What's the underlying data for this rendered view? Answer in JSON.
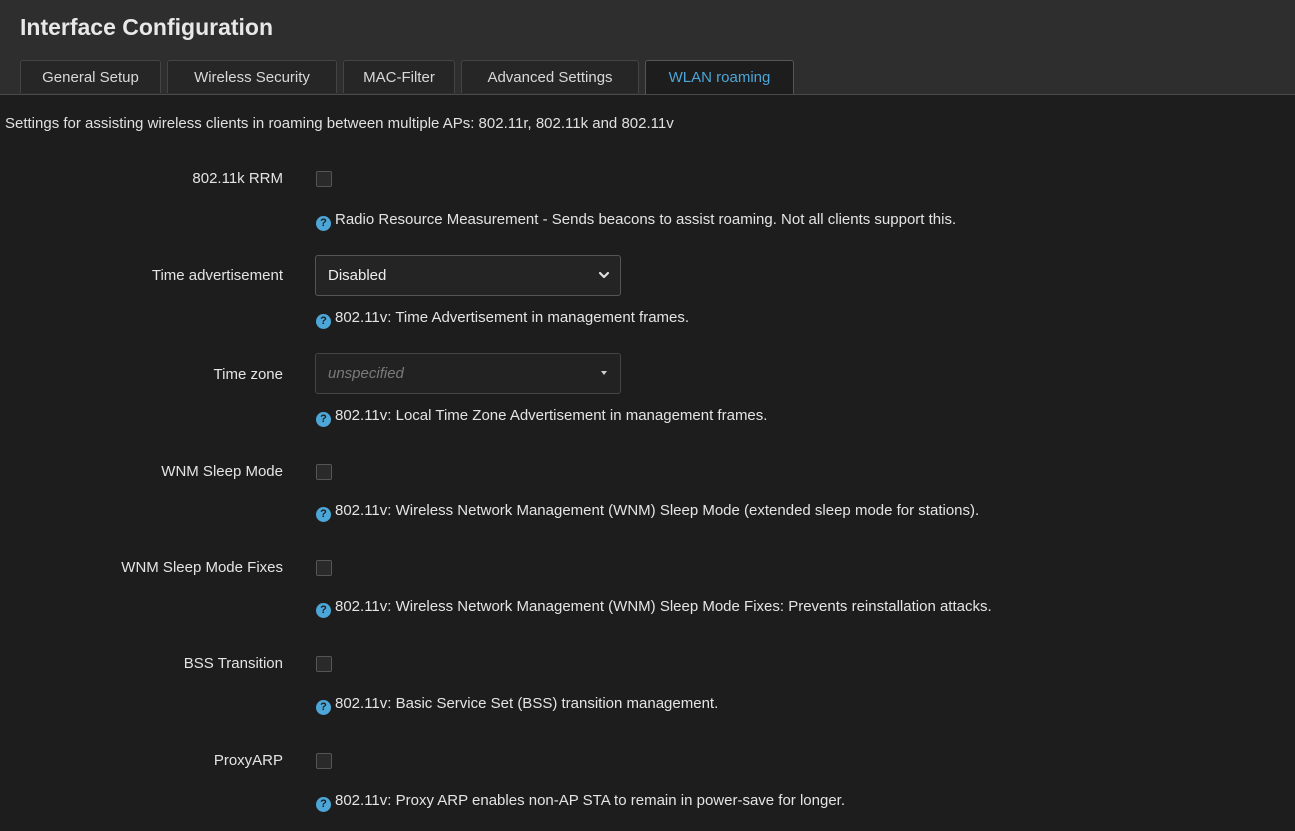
{
  "page": {
    "title": "Interface Configuration"
  },
  "tabs": [
    {
      "label": "General Setup",
      "active": false
    },
    {
      "label": "Wireless Security",
      "active": false
    },
    {
      "label": "MAC-Filter",
      "active": false
    },
    {
      "label": "Advanced Settings",
      "active": false
    },
    {
      "label": "WLAN roaming",
      "active": true
    }
  ],
  "description": "Settings for assisting wireless clients in roaming between multiple APs: 802.11r, 802.11k and 802.11v",
  "fields": {
    "rrm": {
      "label": "802.11k RRM",
      "checked": false,
      "help": "Radio Resource Measurement - Sends beacons to assist roaming. Not all clients support this."
    },
    "time_advertisement": {
      "label": "Time advertisement",
      "value": "Disabled",
      "help": "802.11v: Time Advertisement in management frames."
    },
    "time_zone": {
      "label": "Time zone",
      "placeholder": "unspecified",
      "help": "802.11v: Local Time Zone Advertisement in management frames."
    },
    "wnm_sleep_mode": {
      "label": "WNM Sleep Mode",
      "checked": false,
      "help": "802.11v: Wireless Network Management (WNM) Sleep Mode (extended sleep mode for stations)."
    },
    "wnm_sleep_mode_fixes": {
      "label": "WNM Sleep Mode Fixes",
      "checked": false,
      "help": "802.11v: Wireless Network Management (WNM) Sleep Mode Fixes: Prevents reinstallation attacks."
    },
    "bss_transition": {
      "label": "BSS Transition",
      "checked": false,
      "help": "802.11v: Basic Service Set (BSS) transition management."
    },
    "proxyarp": {
      "label": "ProxyARP",
      "checked": false,
      "help": "802.11v: Proxy ARP enables non-AP STA to remain in power-save for longer."
    }
  },
  "icons": {
    "help": "question-circle-icon",
    "select_arrow": "chevron-down-icon",
    "dropdown_caret": "caret-down-icon"
  },
  "colors": {
    "accent": "#4da6d8",
    "background": "#1d1d1d",
    "header": "#2e2e2e"
  }
}
